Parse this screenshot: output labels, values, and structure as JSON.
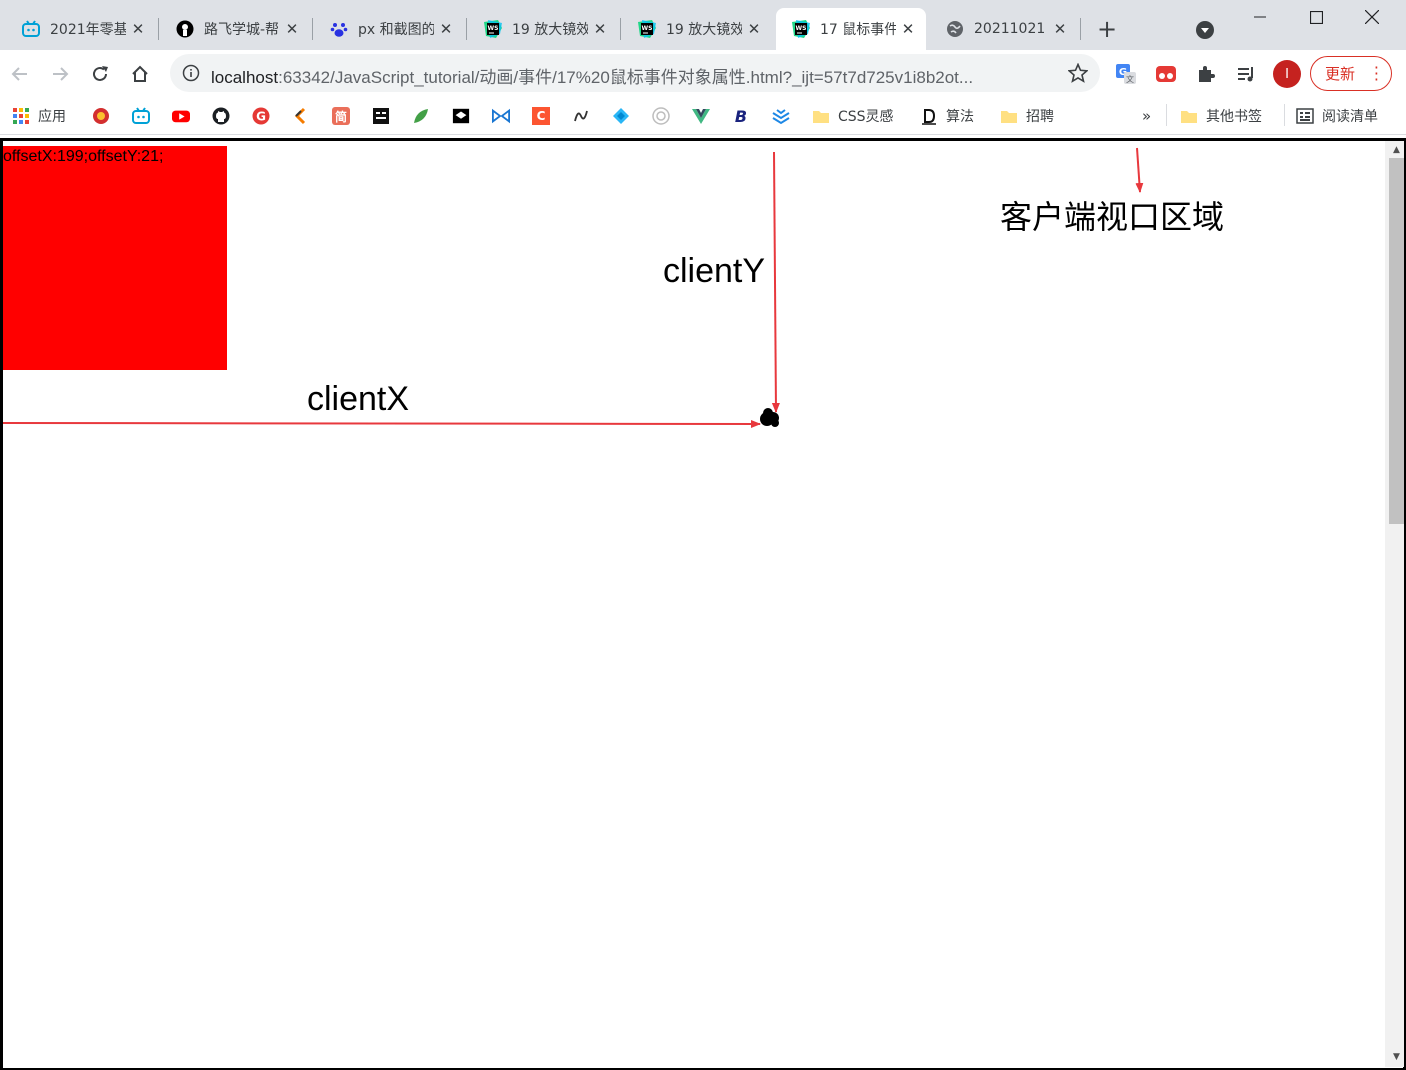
{
  "tabs": [
    {
      "title": "2021年零基",
      "icon": "bilibili-icon"
    },
    {
      "title": "路飞学城-帮",
      "icon": "luffy-icon"
    },
    {
      "title": "px 和截图的",
      "icon": "baidu-paw-icon"
    },
    {
      "title": "19 放大镜效",
      "icon": "webstorm-icon"
    },
    {
      "title": "19 放大镜效",
      "icon": "webstorm-icon"
    },
    {
      "title": "17 鼠标事件",
      "icon": "webstorm-icon",
      "active": true
    },
    {
      "title": "20211021",
      "icon": "globe-icon"
    }
  ],
  "toolbar": {
    "url_host": "localhost",
    "url_rest": ":63342/JavaScript_tutorial/动画/事件/17%20鼠标事件对象属性.html?_ijt=57t7d725v1i8b2ot...",
    "profile_initial": "I",
    "update_label": "更新"
  },
  "bookmarks": {
    "apps_label": "应用",
    "css_label": "CSS灵感",
    "algo_label": "算法",
    "jobs_label": "招聘",
    "more_label": "»",
    "other_label": "其他书签",
    "reading_label": "阅读清单",
    "icon_letters": {
      "jian": "简",
      "c": "C",
      "b": "B",
      "g": "G"
    }
  },
  "page": {
    "readout": "offsetX:199;offsetY:21;",
    "box_color": "#ff0000",
    "arrow_color": "#e8383d",
    "label_clientY": "clientY",
    "label_clientX": "clientX",
    "label_viewport": "客户端视口区域"
  }
}
